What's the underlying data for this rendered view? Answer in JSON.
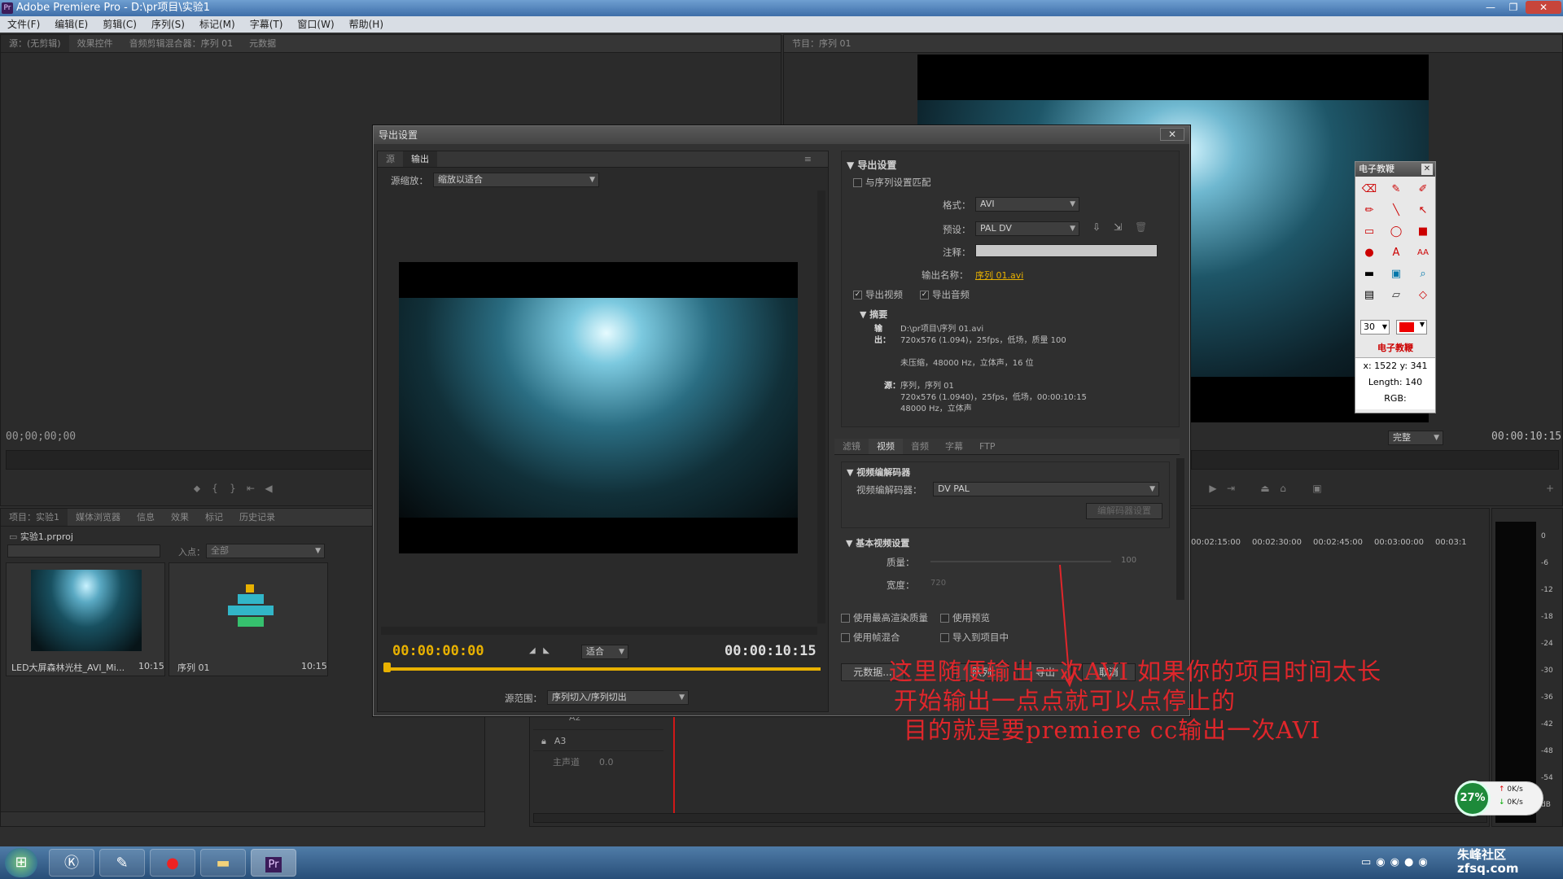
{
  "app_title": "Adobe Premiere Pro - D:\\pr项目\\实验1",
  "menu": [
    "文件(F)",
    "编辑(E)",
    "剪辑(C)",
    "序列(S)",
    "标记(M)",
    "字幕(T)",
    "窗口(W)",
    "帮助(H)"
  ],
  "source_panel": {
    "tabs": [
      "源：(无剪辑)",
      "效果控件",
      "音频剪辑混合器：序列 01",
      "元数据"
    ],
    "timecode": "00;00;00;00"
  },
  "program_panel": {
    "tab": "节目：序列 01",
    "timecode": "00:00:10:15",
    "zoom": "完整"
  },
  "project_panel": {
    "tabs": [
      "项目：实验1",
      "媒体浏览器",
      "信息",
      "效果",
      "标记",
      "历史记录"
    ],
    "project_file": "实验1.prproj",
    "entry_label": "入点：",
    "entry_value": "全部",
    "items": [
      {
        "name": "LED大屏森林光柱_AVI_Mi...",
        "duration": "10:15"
      },
      {
        "name": "序列 01",
        "duration": "10:15"
      }
    ]
  },
  "timeline": {
    "ruler": [
      "00:02:15:00",
      "00:02:30:00",
      "00:02:45:00",
      "00:03:00:00",
      "00:03:1"
    ],
    "tracks": [
      "A2",
      "A3",
      "主声道"
    ],
    "master_value": "0.0"
  },
  "meter_scale": [
    "0",
    "-6",
    "-12",
    "-18",
    "-24",
    "-30",
    "-36",
    "-42",
    "-48",
    "-54",
    "dB"
  ],
  "dialog": {
    "title": "导出设置",
    "tabs": [
      "源",
      "输出"
    ],
    "source_scale_label": "源缩放：",
    "source_scale_value": "缩放以适合",
    "current_tc": "00:00:00:00",
    "fit": "适合",
    "duration_tc": "00:00:10:15",
    "range_label": "源范围：",
    "range_value": "序列切入/序列切出",
    "export_settings": {
      "header": "导出设置",
      "match_seq": "与序列设置匹配",
      "format_label": "格式：",
      "format_value": "AVI",
      "preset_label": "预设：",
      "preset_value": "PAL DV",
      "comment_label": "注释：",
      "output_name_label": "输出名称：",
      "output_name": "序列 01.avi",
      "export_video": "导出视频",
      "export_audio": "导出音频",
      "summary_header": "摘要",
      "output_label": "输出：",
      "output_lines": [
        "D:\\pr项目\\序列 01.avi",
        "720x576 (1.094)，25fps，低场，质量 100",
        "",
        "未压缩，48000 Hz，立体声，16 位"
      ],
      "source_label": "源：",
      "source_lines": [
        "序列，序列 01",
        "720x576 (1.0940)，25fps，低场，00:00:10:15",
        "48000 Hz，立体声"
      ]
    },
    "settings_tabs": [
      "滤镜",
      "视频",
      "音频",
      "字幕",
      "FTP"
    ],
    "video_codec": {
      "header": "视频编解码器",
      "label": "视频编解码器：",
      "value": "DV PAL",
      "button": "编解码器设置"
    },
    "basic_video": {
      "header": "基本视频设置",
      "quality_label": "质量：",
      "quality_value": "100",
      "width_label": "宽度：",
      "width_value": "720"
    },
    "options": [
      "使用最高渲染质量",
      "使用预览",
      "使用帧混合",
      "导入到项目中"
    ],
    "buttons": {
      "metadata": "元数据...",
      "queue": "队列",
      "export": "导出",
      "cancel": "取消"
    }
  },
  "annotation": [
    "这里随便输出一次AVI  如果你的项目时间太长",
    "开始输出一点点就可以点停止的",
    "目的就是要premiere cc输出一次AVI"
  ],
  "ejj": {
    "title": "电子教鞭",
    "size_value": "30",
    "label": "电子教鞭",
    "coords": "x: 1522  y: 341",
    "length": "Length: 140",
    "rgb": "RGB:"
  },
  "net": {
    "percent": "27%",
    "up": "0K/s",
    "down": "0K/s"
  },
  "watermark": "朱峰社区\nzfsq.com",
  "colors": {
    "accent": "#e8b100",
    "annotation_red": "#e0262b",
    "timeline_cursor": "#d01818"
  }
}
